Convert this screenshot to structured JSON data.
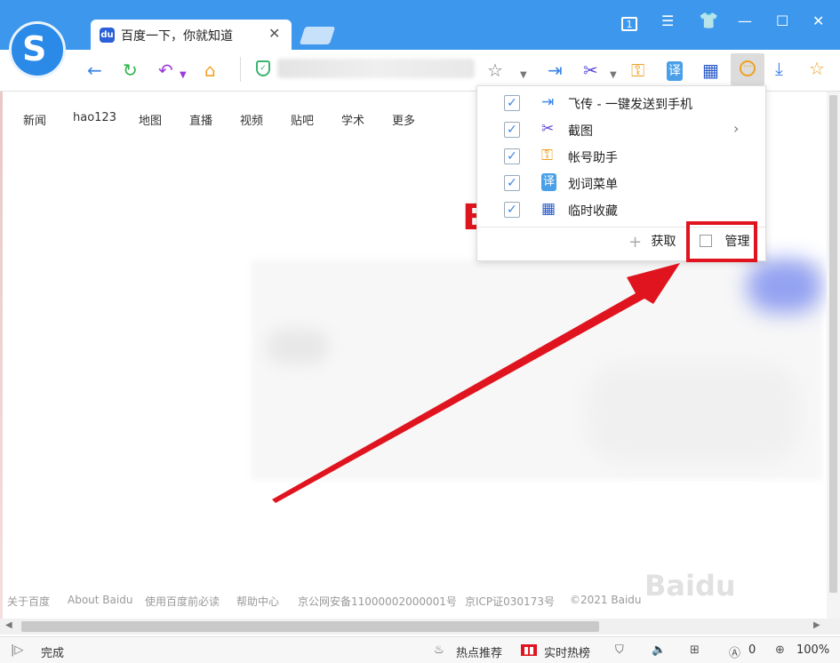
{
  "tab": {
    "title": "百度一下，你就知道",
    "icon": "du",
    "close": "✕"
  },
  "window": {
    "tab_count": "1"
  },
  "nav_links": [
    "新闻",
    "hao123",
    "地图",
    "直播",
    "视频",
    "贴吧",
    "学术",
    "更多"
  ],
  "page": {
    "logo_letter": "B"
  },
  "menu": {
    "items": [
      {
        "label": "飞传 - 一键发送到手机",
        "icon": "send-to-phone-icon",
        "checked": true
      },
      {
        "label": "截图",
        "icon": "scissors-icon",
        "checked": true,
        "has_submenu": true
      },
      {
        "label": "帐号助手",
        "icon": "key-icon",
        "checked": true
      },
      {
        "label": "划词菜单",
        "icon": "translate-icon",
        "checked": true
      },
      {
        "label": "临时收藏",
        "icon": "film-icon",
        "checked": true
      }
    ],
    "fetch_label": "获取",
    "manage_label": "管理"
  },
  "footer": [
    "关于百度",
    "About Baidu",
    "使用百度前必读",
    "帮助中心",
    "京公网安备11000002000001号",
    "京ICP证030173号",
    "©2021 Baidu"
  ],
  "status": {
    "text": "完成",
    "hot_recommend": "热点推荐",
    "realtime_hot": "实时热榜",
    "ad_count": "0",
    "zoom": "100%"
  },
  "colors": {
    "titlebar": "#3d97ec",
    "accent_red": "#e0141e",
    "check": "#3a84e8"
  }
}
